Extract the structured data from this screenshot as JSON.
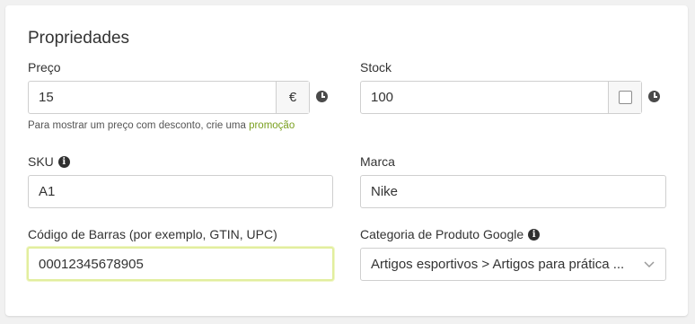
{
  "section": {
    "title": "Propriedades"
  },
  "price": {
    "label": "Preço",
    "value": "15",
    "currency": "€"
  },
  "price_hint": {
    "text": "Para mostrar um preço com desconto, crie uma ",
    "link": "promoção"
  },
  "stock": {
    "label": "Stock",
    "value": "100"
  },
  "sku": {
    "label": "SKU",
    "value": "A1"
  },
  "brand": {
    "label": "Marca",
    "value": "Nike"
  },
  "barcode": {
    "label": "Código de Barras (por exemplo, GTIN, UPC)",
    "value": "00012345678905"
  },
  "google_category": {
    "label": "Categoria de Produto Google",
    "value": "Artigos esportivos > Artigos para prática ..."
  },
  "icons": {
    "schedule": "clock-icon",
    "info": "info-icon",
    "dropdown": "chevron-down-icon"
  },
  "colors": {
    "link": "#7aa01f",
    "focus_border": "#e2ee9e"
  }
}
